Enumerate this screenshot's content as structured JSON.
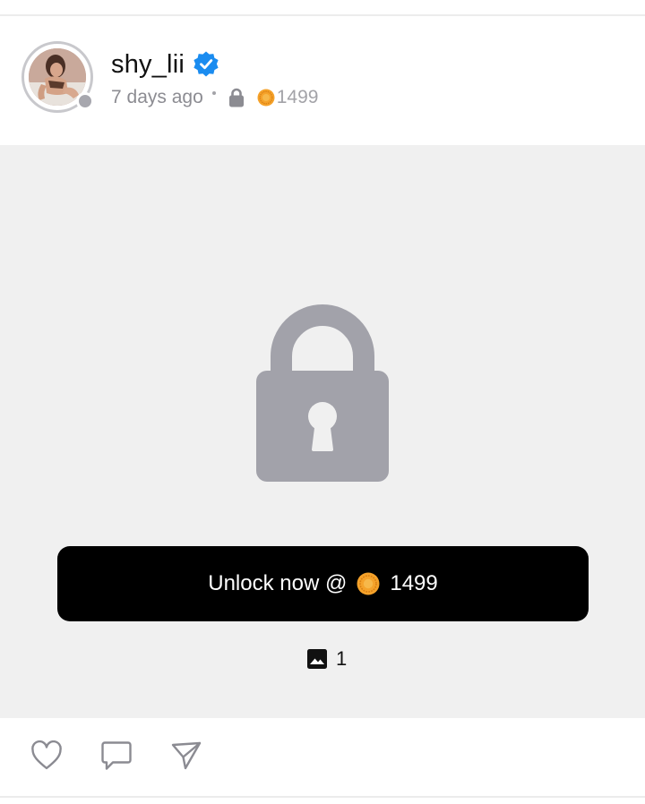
{
  "post": {
    "username": "shy_lii",
    "time_ago": "7 days ago",
    "price": "1499",
    "verified": true,
    "online_status": "offline"
  },
  "locked_media": {
    "unlock_label": "Unlock now @",
    "unlock_price": "1499",
    "image_count": "1"
  },
  "icons": {
    "verified": "verified-badge-icon",
    "lock": "lock-icon",
    "coin": "coin-icon",
    "image": "image-icon",
    "like": "heart-icon",
    "comment": "comment-icon",
    "share": "send-icon"
  },
  "colors": {
    "verified_blue": "#1a8cf0",
    "lock_gray": "#a2a2aa",
    "coin_orange": "#f5a22a",
    "panel_bg": "#f0f0f0",
    "button_bg": "#000000"
  }
}
